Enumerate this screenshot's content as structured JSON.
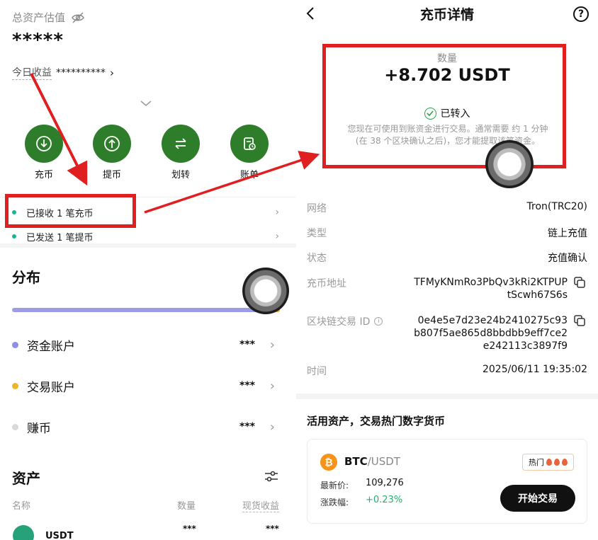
{
  "left": {
    "total_label": "总资产估值",
    "total_value": "*****",
    "today_label": "今日收益",
    "today_value": "**********",
    "actions": [
      {
        "label": "充币",
        "icon": "download-icon"
      },
      {
        "label": "提币",
        "icon": "upload-icon"
      },
      {
        "label": "划转",
        "icon": "transfer-icon"
      },
      {
        "label": "账单",
        "icon": "bill-icon"
      }
    ],
    "notices": [
      {
        "text": "已接收 1 笔充币"
      },
      {
        "text": "已发送 1 笔提币"
      }
    ],
    "distribution_title": "分布",
    "accounts": [
      {
        "label": "资金账户",
        "value": "***",
        "color": "#8f8fe6"
      },
      {
        "label": "交易账户",
        "value": "***",
        "color": "#f0b429"
      },
      {
        "label": "赚币",
        "value": "***",
        "color": "#d9d9d9"
      }
    ],
    "assets_title": "资产",
    "columns": {
      "name": "名称",
      "qty": "数量",
      "pnl": "现货收益"
    },
    "first_asset": {
      "name": "USDT",
      "qty": "***",
      "pnl": "***"
    }
  },
  "right": {
    "title": "充币详情",
    "amount_label": "数量",
    "amount": "+8.702 USDT",
    "status": "已转入",
    "description": "您现在可使用到账资金进行交易。通常需要 约 1 分钟 (在 38 个区块确认之后)，您才能提取该笔资金。",
    "details": [
      {
        "key": "网络",
        "value": "Tron(TRC20)"
      },
      {
        "key": "类型",
        "value": "链上充值"
      },
      {
        "key": "状态",
        "value": "充值确认"
      },
      {
        "key": "充币地址",
        "value": "TFMyKNmRo3PbQv3kRi2KTPUPtScwh67S6s"
      },
      {
        "key": "区块链交易 ID",
        "value": "0e4e5e7d23e24b2410275c93b807f5ae865d8bbdbb9eff7ce2e242113c3897f9"
      },
      {
        "key": "时间",
        "value": "2025/06/11 19:35:02"
      }
    ],
    "promo_title": "活用资产，交易热门数字货币",
    "card": {
      "base": "BTC",
      "quote": "/USDT",
      "hot_label": "热门",
      "last_price_label": "最新价:",
      "last_price": "109,276",
      "change_label": "涨跌幅:",
      "change": "+0.23%",
      "button": "开始交易"
    }
  },
  "colors": {
    "accent_green": "#2d7d2b",
    "annotation_red": "#e02020",
    "positive": "#20b26c",
    "btc_orange": "#f7931a"
  }
}
